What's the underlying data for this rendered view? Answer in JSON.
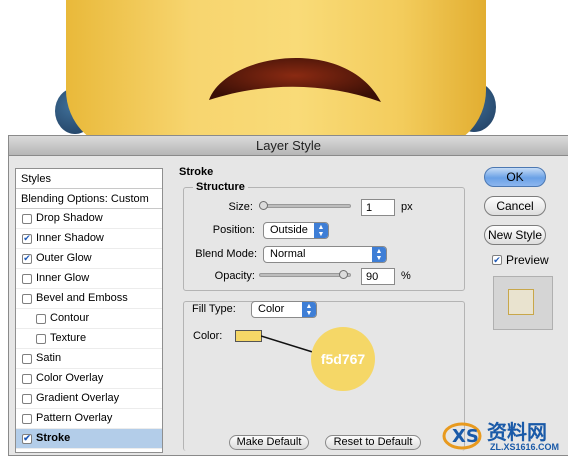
{
  "dialog": {
    "title": "Layer Style",
    "styles_list": {
      "header": "Styles",
      "blending_options": "Blending Options: Custom",
      "items": [
        {
          "label": "Drop Shadow",
          "checked": false
        },
        {
          "label": "Inner Shadow",
          "checked": true
        },
        {
          "label": "Outer Glow",
          "checked": true
        },
        {
          "label": "Inner Glow",
          "checked": false
        },
        {
          "label": "Bevel and Emboss",
          "checked": false
        },
        {
          "label": "Contour",
          "checked": false
        },
        {
          "label": "Texture",
          "checked": false
        },
        {
          "label": "Satin",
          "checked": false
        },
        {
          "label": "Color Overlay",
          "checked": false
        },
        {
          "label": "Gradient Overlay",
          "checked": false
        },
        {
          "label": "Pattern Overlay",
          "checked": false
        },
        {
          "label": "Stroke",
          "checked": true,
          "selected": true
        }
      ]
    },
    "stroke": {
      "title": "Stroke",
      "structure_title": "Structure",
      "size_label": "Size:",
      "size_value": "1",
      "size_unit": "px",
      "position_label": "Position:",
      "position_value": "Outside",
      "blend_mode_label": "Blend Mode:",
      "blend_mode_value": "Normal",
      "opacity_label": "Opacity:",
      "opacity_value": "90",
      "opacity_unit": "%",
      "fill_type_label": "Fill Type:",
      "fill_type_value": "Color",
      "color_label": "Color:",
      "color_hex": "#f5d767",
      "callout_text": "f5d767"
    },
    "bottom_buttons": {
      "make_default": "Make Default",
      "reset_to_default": "Reset to Default"
    },
    "side_buttons": {
      "ok": "OK",
      "cancel": "Cancel",
      "new_style": "New Style",
      "preview": "Preview",
      "preview_checked": true
    }
  },
  "watermark": {
    "text": "资料网",
    "url": "ZL.XS1616.COM"
  },
  "colors": {
    "accent_blue": "#3e7ed6",
    "selected_row": "#b3cde9",
    "face_yellow": "#f5d767"
  }
}
